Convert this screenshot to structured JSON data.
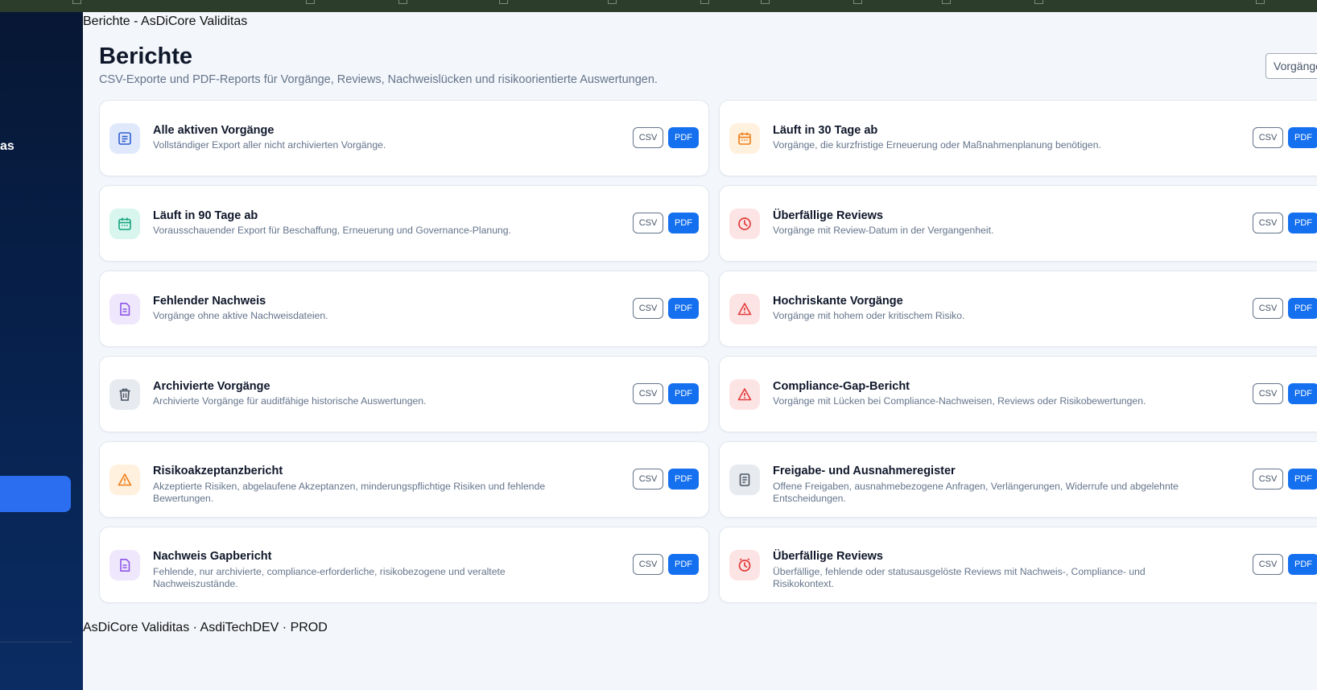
{
  "window": {
    "title": "Berichte - AsDiCore Validitas"
  },
  "sidebar": {
    "brand_fragment": "as"
  },
  "header": {
    "title": "Berichte",
    "subtitle": "CSV-Exporte und PDF-Reports für Vorgänge, Reviews, Nachweislücken und risikoorientierte Auswertungen.",
    "filter_value": "Vorgänge"
  },
  "buttons": {
    "csv": "CSV",
    "pdf": "PDF"
  },
  "colors": {
    "accent": "#1570ef",
    "blue_bg": "#e0e9fb",
    "blue_fg": "#2f5fd0",
    "orange_bg": "#fff1de",
    "orange_fg": "#ef7d17",
    "teal_bg": "#d8f6ee",
    "teal_fg": "#14a37f",
    "red_bg": "#fde4e4",
    "red_fg": "#e23b3b",
    "purple_bg": "#efe8fc",
    "purple_fg": "#8b55e6",
    "gray_bg": "#e7eaef",
    "gray_fg": "#4a5565"
  },
  "reports": [
    {
      "icon": "list-icon",
      "title": "Alle aktiven Vorgänge",
      "description": "Vollständiger Export aller nicht archivierten Vorgänge."
    },
    {
      "icon": "calendar-icon",
      "title": "Läuft in 30 Tage ab",
      "description": "Vorgänge, die kurzfristige Erneuerung oder Maßnahmenplanung benötigen."
    },
    {
      "icon": "calendar-icon",
      "title": "Läuft in 90 Tage ab",
      "description": "Vorausschauender Export für Beschaffung, Erneuerung und Governance-Planung."
    },
    {
      "icon": "clock-icon",
      "title": "Überfällige Reviews",
      "description": "Vorgänge mit Review-Datum in der Vergangenheit."
    },
    {
      "icon": "document-icon",
      "title": "Fehlender Nachweis",
      "description": "Vorgänge ohne aktive Nachweisdateien."
    },
    {
      "icon": "warning-icon",
      "title": "Hochriskante Vorgänge",
      "description": "Vorgänge mit hohem oder kritischem Risiko."
    },
    {
      "icon": "trash-icon",
      "title": "Archivierte Vorgänge",
      "description": "Archivierte Vorgänge für auditfähige historische Auswertungen."
    },
    {
      "icon": "warning-icon",
      "title": "Compliance-Gap-Bericht",
      "description": "Vorgänge mit Lücken bei Compliance-Nachweisen, Reviews oder Risikobewertungen."
    },
    {
      "icon": "warning-icon",
      "title": "Risikoakzeptanzbericht",
      "description": "Akzeptierte Risiken, abgelaufene Akzeptanzen, minderungspflichtige Risiken und fehlende Bewertungen."
    },
    {
      "icon": "register-icon",
      "title": "Freigabe- und Ausnahmeregister",
      "description": "Offene Freigaben, ausnahmebezogene Anfragen, Verlängerungen, Widerrufe und abgelehnte Entscheidungen."
    },
    {
      "icon": "document-icon",
      "title": "Nachweis Gapbericht",
      "description": "Fehlende, nur archivierte, compliance-erforderliche, risikobezogene und veraltete Nachweiszustände."
    },
    {
      "icon": "clock-alert-icon",
      "title": "Überfällige Reviews",
      "description": "Überfällige, fehlende oder statusausgelöste Reviews mit Nachweis-, Compliance- und Risikokontext."
    }
  ],
  "footer": {
    "text": "AsDiCore Validitas · AsdiTechDEV · PROD"
  }
}
